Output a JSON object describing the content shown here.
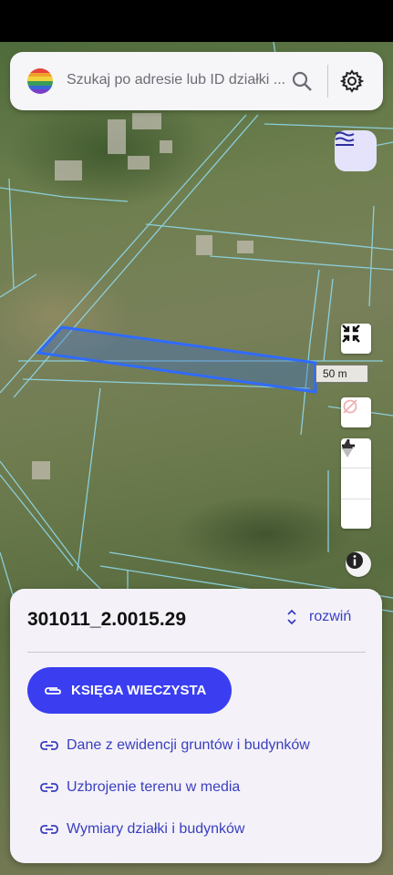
{
  "search": {
    "placeholder": "Szukaj po adresie lub ID działki ...",
    "search_icon": "search-icon",
    "settings_icon": "gear-icon"
  },
  "map": {
    "layers_icon": "layers-icon",
    "fit_icon": "collapse-arrows-icon",
    "scale_label": "50 m",
    "location_off_icon": "location-off-icon",
    "zoom_in_icon": "plus-icon",
    "zoom_out_icon": "minus-icon",
    "compass_icon": "compass-icon",
    "info_icon": "info-icon",
    "parcel_highlight_color": "#2f6bff",
    "boundary_color": "#7fd3e6"
  },
  "panel": {
    "parcel_id": "301011_2.0015.29",
    "expand_label": "rozwiń",
    "primary_button": "KSIĘGA WIECZYSTA",
    "links": [
      "Dane z ewidencji gruntów i budynków",
      "Uzbrojenie terenu w media",
      "Wymiary działki i budynków"
    ]
  },
  "colors": {
    "accent": "#3a3ef0",
    "link": "#3a3ec0",
    "panel_bg": "#f4f2f8"
  }
}
